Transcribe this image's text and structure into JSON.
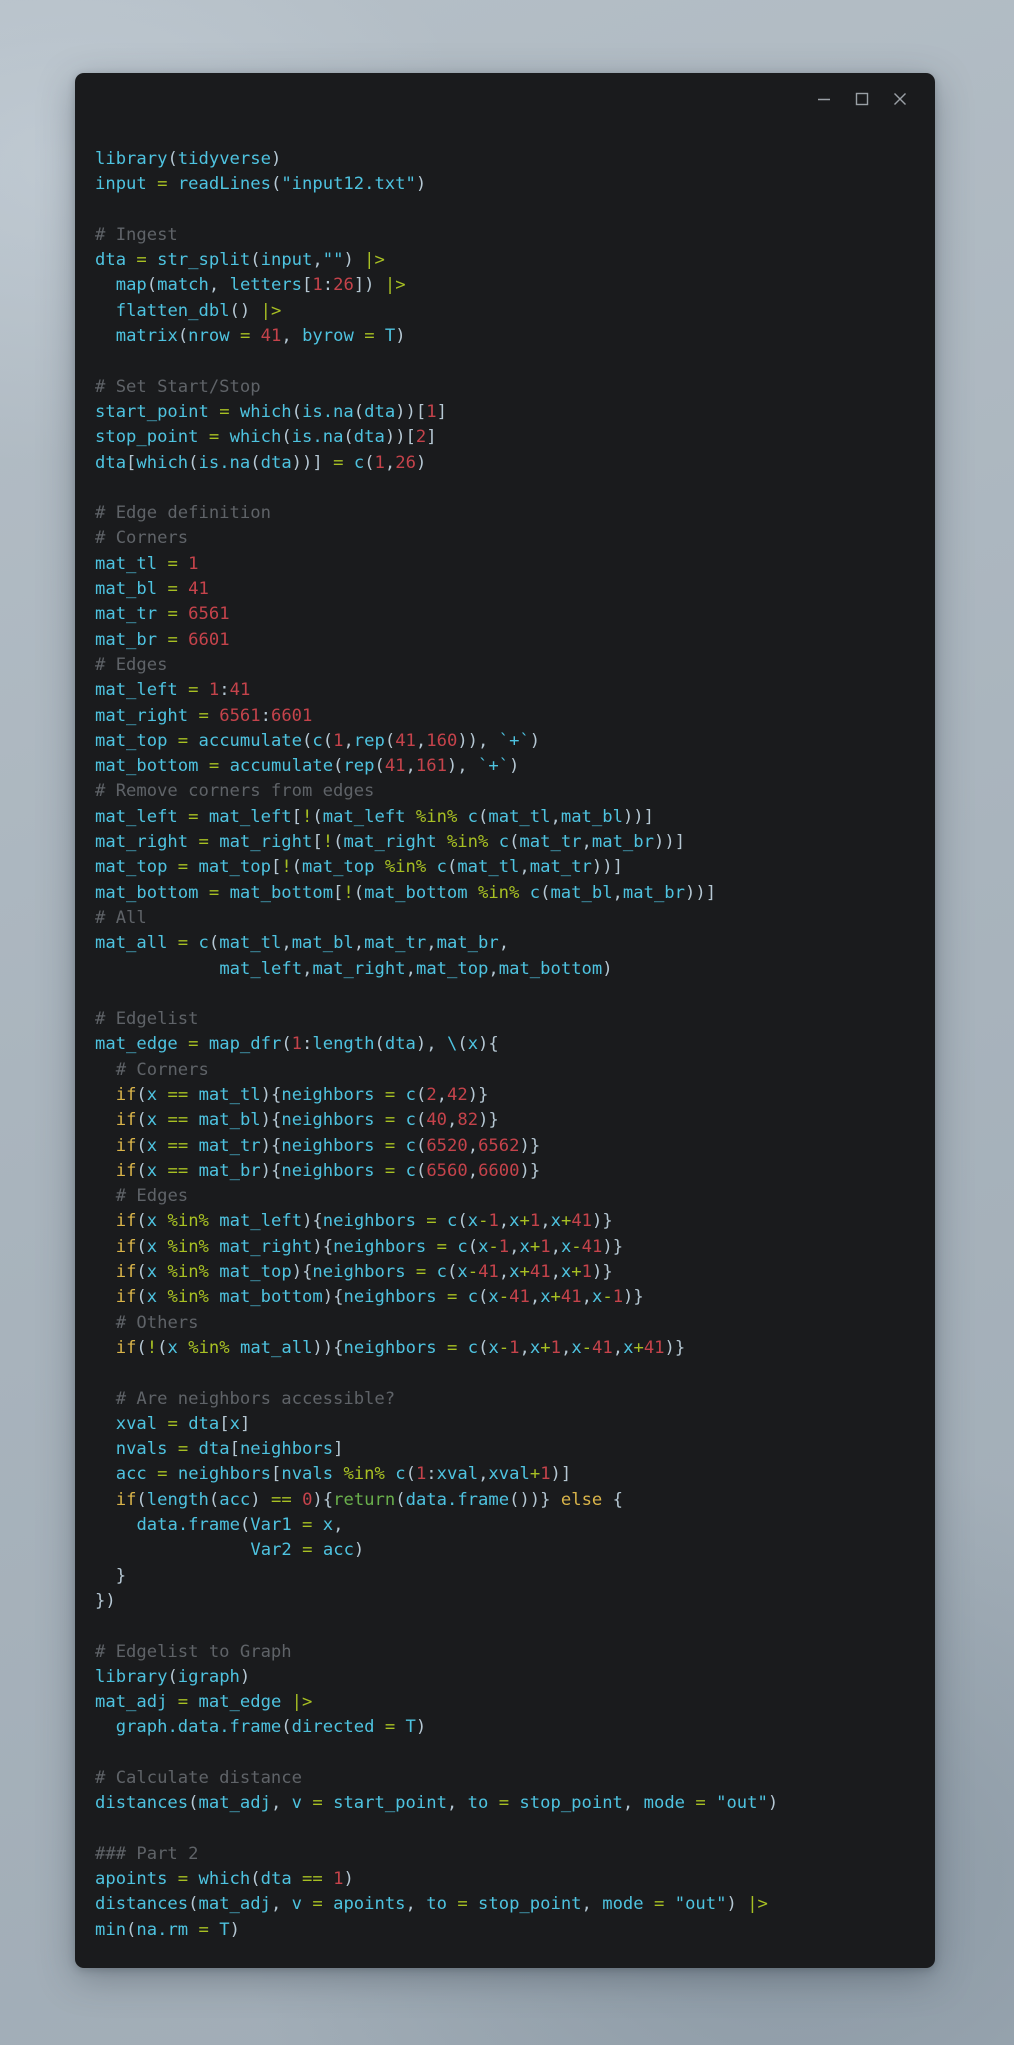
{
  "window": {
    "controls": [
      {
        "name": "minimize",
        "glyph": "minimize-icon",
        "label": "Minimize"
      },
      {
        "name": "maximize",
        "glyph": "maximize-icon",
        "label": "Maximize"
      },
      {
        "name": "close",
        "glyph": "close-icon",
        "label": "Close"
      }
    ],
    "background_color": "#1a1b1d",
    "desktop_color": "#aab5bd"
  },
  "editor": {
    "language": "R",
    "theme_colors": {
      "background": "#1a1b1d",
      "comment": "#5f6368",
      "identifier": "#4ec3e0",
      "operator": "#a8c023",
      "number": "#c5434b",
      "keyword": "#d9b44a",
      "return": "#6ab04c",
      "punctuation": "#b5c7d3"
    },
    "code_lines": [
      "library(tidyverse)",
      "input = readLines(\"input12.txt\")",
      "",
      "# Ingest",
      "dta = str_split(input,\"\") |>",
      "  map(match, letters[1:26]) |>",
      "  flatten_dbl() |>",
      "  matrix(nrow = 41, byrow = T)",
      "",
      "# Set Start/Stop",
      "start_point = which(is.na(dta))[1]",
      "stop_point = which(is.na(dta))[2]",
      "dta[which(is.na(dta))] = c(1,26)",
      "",
      "# Edge definition",
      "# Corners",
      "mat_tl = 1",
      "mat_bl = 41",
      "mat_tr = 6561",
      "mat_br = 6601",
      "# Edges",
      "mat_left = 1:41",
      "mat_right = 6561:6601",
      "mat_top = accumulate(c(1,rep(41,160)), `+`)",
      "mat_bottom = accumulate(rep(41,161), `+`)",
      "# Remove corners from edges",
      "mat_left = mat_left[!(mat_left %in% c(mat_tl,mat_bl))]",
      "mat_right = mat_right[!(mat_right %in% c(mat_tr,mat_br))]",
      "mat_top = mat_top[!(mat_top %in% c(mat_tl,mat_tr))]",
      "mat_bottom = mat_bottom[!(mat_bottom %in% c(mat_bl,mat_br))]",
      "# All",
      "mat_all = c(mat_tl,mat_bl,mat_tr,mat_br,",
      "            mat_left,mat_right,mat_top,mat_bottom)",
      "",
      "# Edgelist",
      "mat_edge = map_dfr(1:length(dta), \\(x){",
      "  # Corners",
      "  if(x == mat_tl){neighbors = c(2,42)}",
      "  if(x == mat_bl){neighbors = c(40,82)}",
      "  if(x == mat_tr){neighbors = c(6520,6562)}",
      "  if(x == mat_br){neighbors = c(6560,6600)}",
      "  # Edges",
      "  if(x %in% mat_left){neighbors = c(x-1,x+1,x+41)}",
      "  if(x %in% mat_right){neighbors = c(x-1,x+1,x-41)}",
      "  if(x %in% mat_top){neighbors = c(x-41,x+41,x+1)}",
      "  if(x %in% mat_bottom){neighbors = c(x-41,x+41,x-1)}",
      "  # Others",
      "  if(!(x %in% mat_all)){neighbors = c(x-1,x+1,x-41,x+41)}",
      "",
      "  # Are neighbors accessible?",
      "  xval = dta[x]",
      "  nvals = dta[neighbors]",
      "  acc = neighbors[nvals %in% c(1:xval,xval+1)]",
      "  if(length(acc) == 0){return(data.frame())} else {",
      "    data.frame(Var1 = x,",
      "               Var2 = acc)",
      "  }",
      "})",
      "",
      "# Edgelist to Graph",
      "library(igraph)",
      "mat_adj = mat_edge |>",
      "  graph.data.frame(directed = T)",
      "",
      "# Calculate distance",
      "distances(mat_adj, v = start_point, to = stop_point, mode = \"out\")",
      "",
      "### Part 2",
      "apoints = which(dta == 1)",
      "distances(mat_adj, v = apoints, to = stop_point, mode = \"out\") |>",
      "min(na.rm = T)"
    ]
  }
}
